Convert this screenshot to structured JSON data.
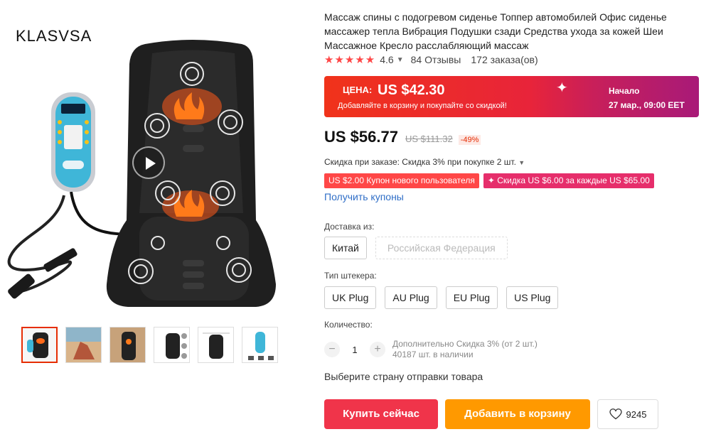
{
  "gallery": {
    "brand": "KLASVSA",
    "thumb_count": 6,
    "active_thumb": 0
  },
  "product": {
    "title": "Массаж спины с подогревом сиденье Топпер автомобилей Офис сиденье массажер тепла Вибрация Подушки сзади Средства ухода за кожей Шеи Массажное Кресло расслабляющий массаж",
    "rating": "4.6",
    "stars": "★★★★★",
    "reviews": "84 Отзывы",
    "orders": "172 заказа(ов)"
  },
  "promo": {
    "price_label": "ЦЕНА:",
    "price": "US $42.30",
    "subtitle": "Добавляйте в корзину и покупайте со скидкой!",
    "start_label": "Начало",
    "start_date": "27 мар., 09:00 EET"
  },
  "price": {
    "current": "US $56.77",
    "original": "US $111.32",
    "discount": "-49%"
  },
  "discounts": {
    "order_discount": "Скидка при заказе: Скидка 3% при покупке 2 шт.",
    "coupons": [
      "US $2.00 Купон нового пользователя",
      "✦ Скидка US $6.00 за каждые US $65.00"
    ],
    "get_coupons": "Получить купоны"
  },
  "shipping": {
    "label": "Доставка из:",
    "options": [
      "Китай",
      "Российская Федерация"
    ]
  },
  "plug": {
    "label": "Тип штекера:",
    "options": [
      "UK Plug",
      "AU Plug",
      "EU Plug",
      "US Plug"
    ]
  },
  "quantity": {
    "label": "Количество:",
    "minus": "−",
    "value": "1",
    "plus": "+",
    "note": "Дополнительно Скидка 3% (от 2 шт.)",
    "stock": "40187 шт. в наличии"
  },
  "ship_note": "Выберите страну отправки товара",
  "actions": {
    "buy": "Купить сейчас",
    "cart": "Добавить в корзину",
    "wishlist_count": "9245"
  },
  "colors": {
    "accent": "#ff4747",
    "buy": "#f0344a",
    "cart": "#ff9900",
    "link": "#2f6ec7"
  }
}
